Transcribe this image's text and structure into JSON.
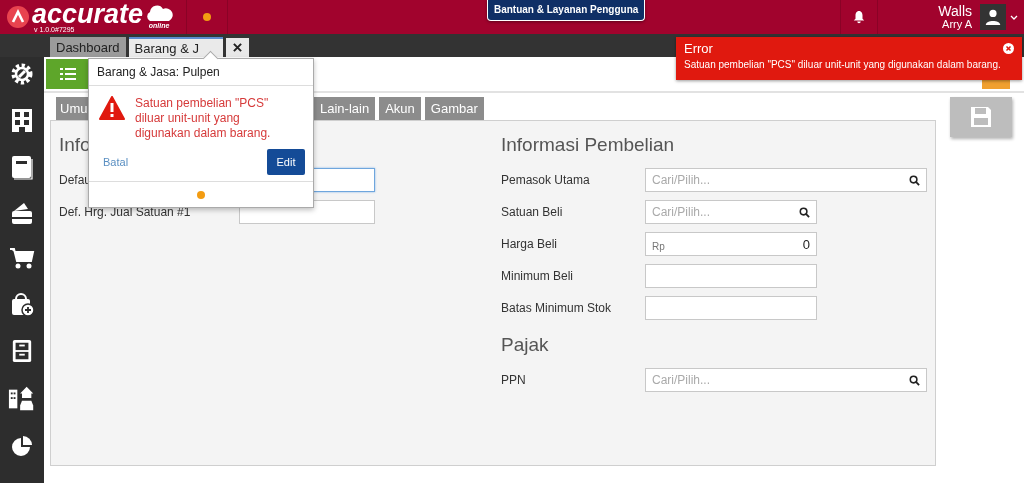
{
  "header": {
    "logo": {
      "name": "accurate",
      "sub": "online",
      "version": "v 1.0.0#7295"
    },
    "help_button": "Bantuan & Layanan Pengguna",
    "user": {
      "name": "Walls",
      "subtitle": "Arry A"
    }
  },
  "doc_tabs": [
    {
      "label": "Dashboard",
      "selected": false
    },
    {
      "label": "Barang & J",
      "selected": true
    }
  ],
  "form_tabs": [
    {
      "label": "Umu"
    },
    {
      "label": "Lain-lain"
    },
    {
      "label": "Akun"
    },
    {
      "label": "Gambar"
    }
  ],
  "general_section": {
    "title": "Info",
    "fields": [
      {
        "label": "Defau",
        "focused": true
      },
      {
        "label": "Def. Hrg. Jual Satuan #1",
        "focused": false
      }
    ]
  },
  "purchase_section": {
    "title": "Informasi Pembelian",
    "fields": [
      {
        "label": "Pemasok Utama",
        "kind": "search",
        "wide": true,
        "placeholder": "Cari/Pilih..."
      },
      {
        "label": "Satuan Beli",
        "kind": "search",
        "wide": false,
        "placeholder": "Cari/Pilih..."
      },
      {
        "label": "Harga Beli",
        "kind": "currency",
        "wide": false,
        "prefix": "Rp",
        "value": "0"
      },
      {
        "label": "Minimum Beli",
        "kind": "text",
        "wide": false
      },
      {
        "label": "Batas Minimum Stok",
        "kind": "text",
        "wide": false
      }
    ]
  },
  "tax_section": {
    "title": "Pajak",
    "fields": [
      {
        "label": "PPN",
        "kind": "search",
        "wide": true,
        "placeholder": "Cari/Pilih..."
      }
    ]
  },
  "error_toast": {
    "title": "Error",
    "message": "Satuan pembelian \"PCS\" diluar unit-unit yang digunakan dalam barang."
  },
  "popover": {
    "title": "Barang & Jasa: Pulpen",
    "message": "Satuan pembelian \"PCS\" diluar unit-unit yang digunakan dalam barang.",
    "buttons": [
      {
        "label": "Batal",
        "kind": "link"
      },
      {
        "label": "Edit",
        "kind": "primary"
      }
    ]
  }
}
